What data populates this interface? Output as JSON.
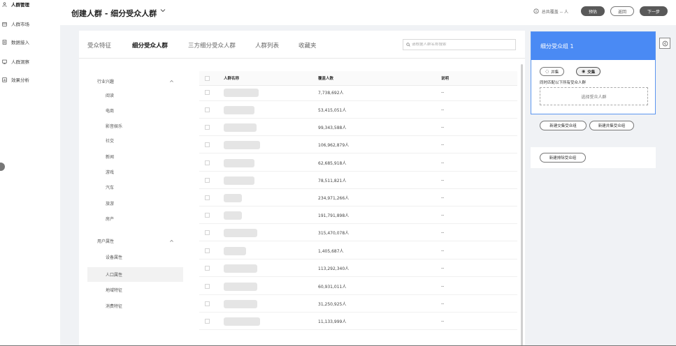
{
  "sidebar": {
    "items": [
      {
        "label": "人群管理",
        "icon": "person-icon",
        "active": true
      },
      {
        "label": "人群市场",
        "icon": "market-icon",
        "active": false
      },
      {
        "label": "数据接入",
        "icon": "data-icon",
        "active": false
      },
      {
        "label": "人群洞察",
        "icon": "insight-icon",
        "active": false
      },
      {
        "label": "效果分析",
        "icon": "analysis-icon",
        "active": false
      }
    ]
  },
  "header": {
    "title": "创建人群 - 细分受众人群",
    "cover_text": "总共覆盖 -- 人",
    "btn_estimate": "预估",
    "btn_back": "返回",
    "btn_next": "下一步"
  },
  "tabs": [
    {
      "label": "受众特征",
      "active": false
    },
    {
      "label": "细分受众人群",
      "active": true
    },
    {
      "label": "三方细分受众人群",
      "active": false
    },
    {
      "label": "人群列表",
      "active": false
    },
    {
      "label": "收藏夹",
      "active": false
    }
  ],
  "search": {
    "placeholder": "请根据人群名称搜索"
  },
  "categories": {
    "group1": {
      "label": "行业兴趣",
      "items": [
        "阅读",
        "电商",
        "影音娱乐",
        "社交",
        "新闻",
        "游戏",
        "汽车",
        "旅游",
        "房产"
      ]
    },
    "group2": {
      "label": "用户属性",
      "items": [
        "设备属性",
        "人口属性",
        "地域特征",
        "消费特征"
      ]
    },
    "active_item": "人口属性"
  },
  "table": {
    "headers": {
      "name": "人群名称",
      "cover": "覆盖人数",
      "desc": "说明"
    },
    "rows": [
      {
        "cover": "7,738,692人",
        "desc": "--"
      },
      {
        "cover": "53,415,051人",
        "desc": "--"
      },
      {
        "cover": "99,343,588人",
        "desc": "--"
      },
      {
        "cover": "106,962,879人",
        "desc": "--"
      },
      {
        "cover": "62,685,918人",
        "desc": "--"
      },
      {
        "cover": "78,511,821人",
        "desc": "--"
      },
      {
        "cover": "234,971,266人",
        "desc": "--"
      },
      {
        "cover": "191,791,898人",
        "desc": "--"
      },
      {
        "cover": "315,470,078人",
        "desc": "--"
      },
      {
        "cover": "1,405,687人",
        "desc": "--"
      },
      {
        "cover": "113,292,340人",
        "desc": "--"
      },
      {
        "cover": "60,931,011人",
        "desc": "--"
      },
      {
        "cover": "31,250,925人",
        "desc": "--"
      },
      {
        "cover": "11,133,999人",
        "desc": "--"
      }
    ]
  },
  "group_panel": {
    "title": "细分受众组 1",
    "union_label": "并集",
    "intersect_label": "交集",
    "match_hint": "同时匹配以下所有受众人群",
    "select_label": "选择受众人群"
  },
  "actions": {
    "new_intersect": "新建交集受众组",
    "new_union": "新建并集受众组",
    "new_exclude": "新建排除受众组"
  }
}
